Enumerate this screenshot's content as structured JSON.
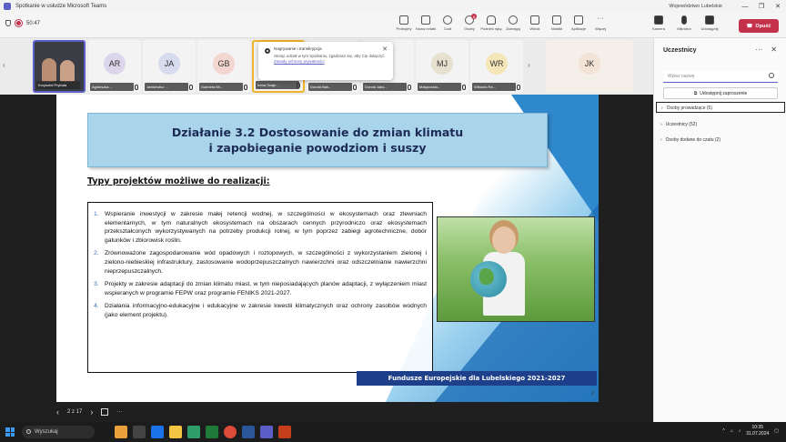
{
  "window": {
    "title": "Spotkanie w usłudze Microsoft Teams",
    "org": "Województwo Lubelskie",
    "controls": [
      "—",
      "❐",
      "✕"
    ]
  },
  "toolbar": {
    "timer": "50:47",
    "items": [
      {
        "label": "Próbujmy",
        "icon": "screen-icon"
      },
      {
        "label": "Nowa notatk",
        "icon": "note-icon"
      },
      {
        "label": "Czat",
        "icon": "chat-icon"
      },
      {
        "label": "Osoby",
        "icon": "people-icon",
        "badge": "8"
      },
      {
        "label": "Podnieś rękę",
        "icon": "hand-icon"
      },
      {
        "label": "Zareaguj",
        "icon": "emoji-icon"
      },
      {
        "label": "Widok",
        "icon": "grid-icon"
      },
      {
        "label": "Notatki",
        "icon": "notes-icon"
      },
      {
        "label": "Aplikacje",
        "icon": "apps-icon"
      },
      {
        "label": "Więcej",
        "icon": "more-icon"
      }
    ],
    "right_items": [
      {
        "label": "Kamera",
        "icon": "camera-icon"
      },
      {
        "label": "Mikrofon",
        "icon": "microphone-icon"
      },
      {
        "label": "Udostępnij",
        "icon": "share-icon"
      }
    ],
    "leave_label": "Opuść",
    "accent": "#5b5fc7",
    "leave_color": "#c4314b"
  },
  "participants": [
    {
      "name": "Krzysztof Prybuła",
      "initials": "",
      "video": true
    },
    {
      "name": "Agnieszka ...",
      "initials": "AR",
      "color": "#dcd6ea"
    },
    {
      "name": "Jankiewicz ...",
      "initials": "JA",
      "color": "#d6dcee"
    },
    {
      "name": "Gabriela Bil...",
      "initials": "GB",
      "color": "#f2d6cf"
    },
    {
      "name": "Irena Szajn...",
      "initials": "",
      "color": "#f3f3f3"
    },
    {
      "name": "Dorota Bak...",
      "initials": "",
      "color": "#f3f3f3"
    },
    {
      "name": "Dorota Jaks...",
      "initials": "",
      "color": "#f3f3f3"
    },
    {
      "name": "Małgorzata...",
      "initials": "MJ",
      "color": "#e6e0cf"
    },
    {
      "name": "Wiktoria Ra...",
      "initials": "WR",
      "color": "#f5e6b8"
    },
    {
      "name": "",
      "initials": "JK",
      "color": "#f3e2d6"
    }
  ],
  "popup": {
    "title": "Nagrywanie i transkrypcja",
    "body": "Storąc udział w tym spotkaniu, zgadzasz się, aby Cię dołączyć.",
    "link": "Zasady ochrony prywatności",
    "close": "✕"
  },
  "slide": {
    "title_line1": "Działanie 3.2 Dostosowanie do zmian klimatu",
    "title_line2": "i zapobieganie powodziom i suszy",
    "subheading": "Typy projektów możliwe do realizacji:",
    "items": [
      {
        "num": "1.",
        "text": "Wspieranie inwestycji w zakresie małej retencji wodnej, w szczególności w ekosystemach oraz zlewniach elementarnych, w tym naturalnych ekosystemach na obszarach cennych przyrodniczo oraz ekosystemach przekształconych wykorzystywanych na potrzeby produkcji rolnej, w tym poprzez zabiegi agrotechniczne, dobór gatunków i zbiorowisk roślin."
      },
      {
        "num": "2.",
        "text": "Zrównoważone zagospodarowanie wód opadowych i roztopowych, w szczególności z wykorzystaniem zielonej i zielono-niebieskiej infrastruktury, zastosowanie wodoprzepuszczalnych nawierzchni oraz odszczelnianie nawierzchni nieprzepuszczalnych."
      },
      {
        "num": "3.",
        "text": "Projekty w zakresie adaptacji do zmian klimatu miast, w tym nieposiadających planów adaptacji, z wyłączeniem miast wspieranych w programie FEPW oraz programie FENIKS 2021-2027."
      },
      {
        "num": "4.",
        "text": "Działania informacyjno-edukacyjne i edukacyjne w zakresie kwestii klimatycznych oraz ochrony zasobów wodnych (jako element projektu)."
      }
    ],
    "footer": "Fundusze Europejskie dla Lubelskiego 2021-2027",
    "page_number": "2"
  },
  "slide_nav": {
    "counter": "2 z 17",
    "prev": "‹",
    "next": "›",
    "more": "···"
  },
  "panel": {
    "title": "Uczestnicy",
    "search_placeholder": "Wpisz nazwę",
    "share_label": "Udostępnij zaproszenie",
    "sections": [
      {
        "label": "Osoby prowadzące (5)"
      },
      {
        "label": "Uczestnicy (52)"
      },
      {
        "label": "Osoby dodane do czatu (2)"
      }
    ]
  },
  "taskbar": {
    "search_label": "Wyszukaj",
    "time": "10:35",
    "date": "31.07.2024"
  }
}
